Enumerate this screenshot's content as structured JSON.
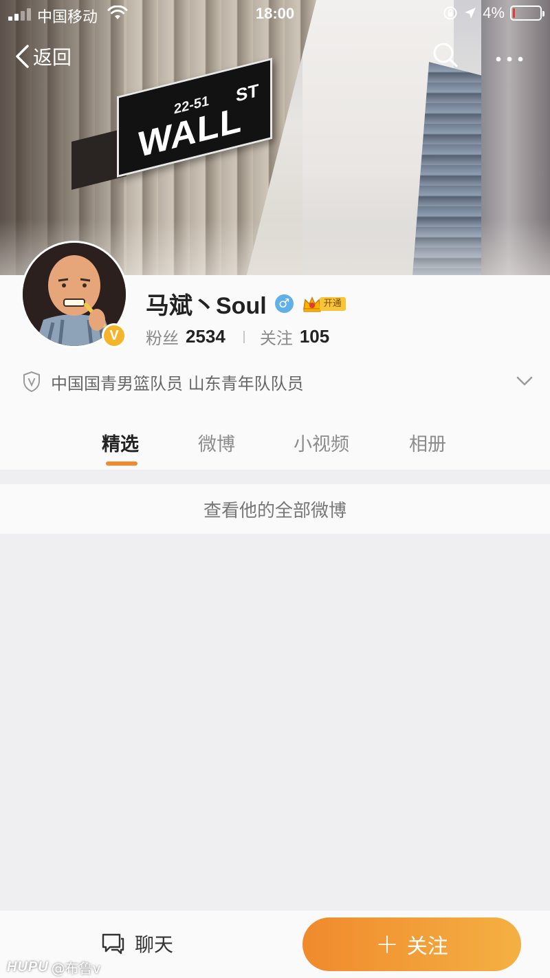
{
  "status_bar": {
    "carrier": "中国移动",
    "time": "18:00",
    "battery_percent": "4%",
    "signal_bars": 2
  },
  "nav": {
    "back_label": "返回"
  },
  "cover": {
    "sign_numbers": "22-51",
    "sign_street": "WALL",
    "sign_suffix": "ST"
  },
  "profile": {
    "name": "马斌丶Soul",
    "verified_badge": "V",
    "gender_symbol": "♂",
    "vip_label": "开通",
    "fans_label": "粉丝",
    "fans_count": "2534",
    "following_label": "关注",
    "following_count": "105",
    "description": "中国国青男篮队员 山东青年队队员"
  },
  "tabs": [
    {
      "label": "精选",
      "active": true
    },
    {
      "label": "微博",
      "active": false
    },
    {
      "label": "小视频",
      "active": false
    },
    {
      "label": "相册",
      "active": false
    }
  ],
  "content": {
    "view_all_label": "查看他的全部微博"
  },
  "bottom_bar": {
    "chat_label": "聊天",
    "follow_label": "关注",
    "follow_plus": "+"
  },
  "watermark": {
    "logo": "HUPU",
    "handle": "@布鲁v"
  },
  "colors": {
    "accent_orange": "#f08a2c",
    "accent_orange_light": "#f4b043",
    "verified_gold": "#f6b42a",
    "gender_blue": "#5fb0e8",
    "battery_low": "#e53935"
  }
}
